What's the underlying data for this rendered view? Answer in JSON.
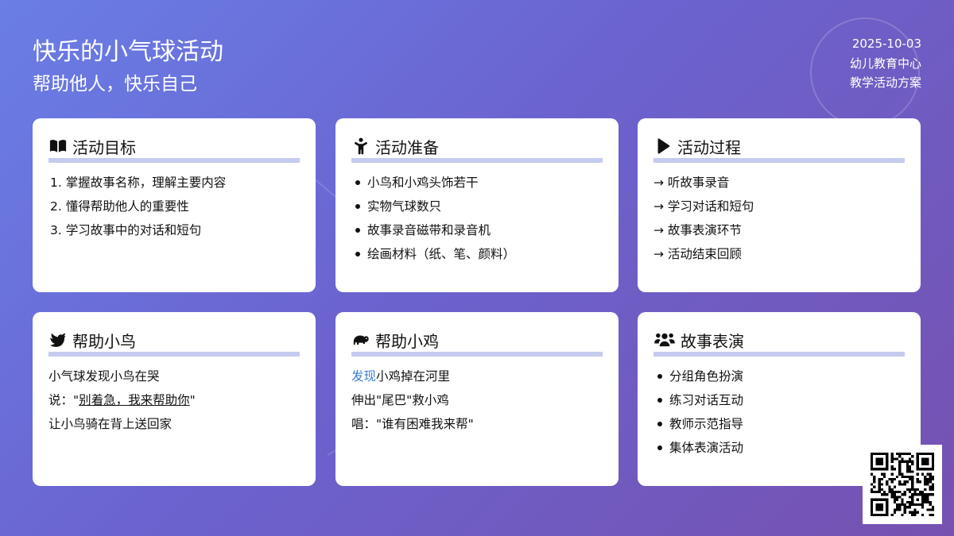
{
  "header": {
    "title": "快乐的小气球活动",
    "subtitle": "帮助他人，快乐自己",
    "date": "2025-10-03",
    "org": "幼儿教育中心",
    "doc_type": "教学活动方案"
  },
  "cards": {
    "goals": {
      "title": "活动目标",
      "icon": "book-icon",
      "items": [
        "1. 掌握故事名称，理解主要内容",
        "2. 懂得帮助他人的重要性",
        "3. 学习故事中的对话和短句"
      ]
    },
    "prep": {
      "title": "活动准备",
      "icon": "child-icon",
      "items": [
        "小鸟和小鸡头饰若干",
        "实物气球数只",
        "故事录音磁带和录音机",
        "绘画材料（纸、笔、颜料）"
      ]
    },
    "process": {
      "title": "活动过程",
      "icon": "play-icon",
      "items": [
        "→ 听故事录音",
        "→ 学习对话和短句",
        "→ 故事表演环节",
        "→ 活动结束回顾"
      ]
    },
    "bird": {
      "title": "帮助小鸟",
      "icon": "dove-icon",
      "line1": "小气球发现小鸟在哭",
      "line2_prefix": "说：\"",
      "line2_underlined": "别着急，我来帮助你",
      "line2_suffix": "\"",
      "line3": "让小鸟骑在背上送回家"
    },
    "chick": {
      "title": "帮助小鸡",
      "icon": "hippo-icon",
      "line1_highlight": "发现",
      "line1_rest": "小鸡掉在河里",
      "line2": "伸出\"尾巴\"救小鸡",
      "line3": "唱：\"谁有困难我来帮\""
    },
    "performance": {
      "title": "故事表演",
      "icon": "users-icon",
      "items": [
        "分组角色扮演",
        "练习对话互动",
        "教师示范指导",
        "集体表演活动"
      ]
    }
  },
  "colors": {
    "accent_bar": "#c5cbee",
    "highlight": "#3b7dd8"
  }
}
